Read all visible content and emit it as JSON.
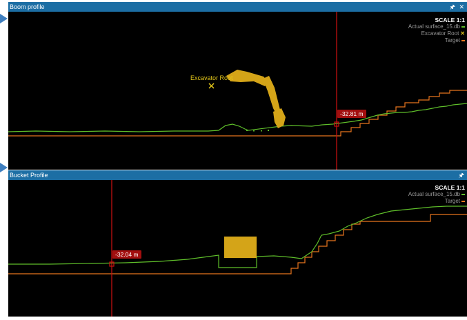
{
  "boom_panel": {
    "title": "Boom profile",
    "pin_icon": "pin-icon",
    "close_icon": "close-icon",
    "scale": "SCALE 1:1",
    "legend": [
      {
        "label": "Actual surface_15.db",
        "color": "#5fbf2a"
      },
      {
        "label": "Excavator Root",
        "color": "#e3c61a"
      },
      {
        "label": "Target",
        "color": "#e8751d"
      }
    ],
    "root_label": "Excavator Root",
    "readout": "-32.81 m"
  },
  "bucket_panel": {
    "title": "Bucket Profile",
    "pin_icon": "pin-icon",
    "scale": "SCALE 1:1",
    "legend": [
      {
        "label": "Actual surface_15.db",
        "color": "#5fbf2a"
      },
      {
        "label": "Target",
        "color": "#e8751d"
      }
    ],
    "readout": "-32.04 m"
  },
  "colors": {
    "surface": "#5fbf2a",
    "target": "#e8751d",
    "machine": "#d4a418",
    "cursor": "#d01010",
    "titlebar": "#1c6ea4"
  }
}
